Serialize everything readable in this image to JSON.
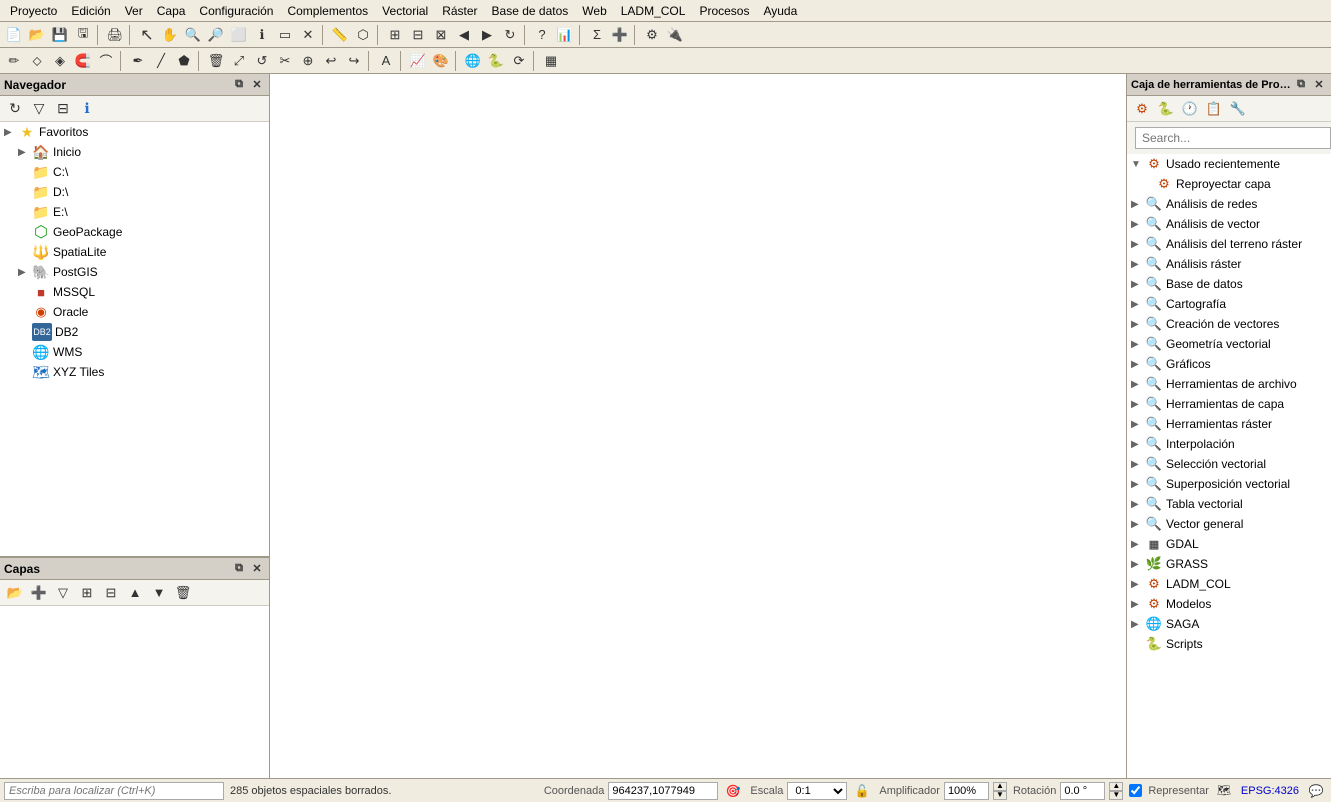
{
  "menu": {
    "items": [
      "Proyecto",
      "Edición",
      "Ver",
      "Capa",
      "Configuración",
      "Complementos",
      "Vectorial",
      "Ráster",
      "Base de datos",
      "Web",
      "LADM_COL",
      "Procesos",
      "Ayuda"
    ]
  },
  "navigator": {
    "title": "Navegador",
    "favorites_label": "Favoritos",
    "items": [
      {
        "label": "Inicio",
        "type": "folder",
        "hasArrow": true
      },
      {
        "label": "C:\\",
        "type": "folder",
        "hasArrow": false
      },
      {
        "label": "D:\\",
        "type": "folder",
        "hasArrow": false
      },
      {
        "label": "E:\\",
        "type": "folder",
        "hasArrow": false
      },
      {
        "label": "GeoPackage",
        "type": "geopkg",
        "hasArrow": false
      },
      {
        "label": "SpatiaLite",
        "type": "spatialite",
        "hasArrow": false
      },
      {
        "label": "PostGIS",
        "type": "postgis",
        "hasArrow": true
      },
      {
        "label": "MSSQL",
        "type": "mssql",
        "hasArrow": false
      },
      {
        "label": "Oracle",
        "type": "oracle",
        "hasArrow": false
      },
      {
        "label": "DB2",
        "type": "db2",
        "hasArrow": false
      },
      {
        "label": "WMS",
        "type": "wms",
        "hasArrow": false
      },
      {
        "label": "XYZ Tiles",
        "type": "xyz",
        "hasArrow": false
      }
    ]
  },
  "layers": {
    "title": "Capas"
  },
  "toolbox": {
    "title": "Caja de herramientas de Proc...",
    "search_placeholder": "Search...",
    "recently_used": "Usado recientemente",
    "recently_items": [
      "Reproyectar capa"
    ],
    "categories": [
      {
        "label": "Análisis de redes"
      },
      {
        "label": "Análisis de vector"
      },
      {
        "label": "Análisis del terreno ráster"
      },
      {
        "label": "Análisis ráster"
      },
      {
        "label": "Base de datos"
      },
      {
        "label": "Cartografía"
      },
      {
        "label": "Creación de vectores"
      },
      {
        "label": "Geometría vectorial"
      },
      {
        "label": "Gráficos"
      },
      {
        "label": "Herramientas de archivo"
      },
      {
        "label": "Herramientas de capa"
      },
      {
        "label": "Herramientas ráster"
      },
      {
        "label": "Interpolación"
      },
      {
        "label": "Selección vectorial"
      },
      {
        "label": "Superposición vectorial"
      },
      {
        "label": "Tabla vectorial"
      },
      {
        "label": "Vector general"
      },
      {
        "label": "GDAL"
      },
      {
        "label": "GRASS"
      },
      {
        "label": "LADM_COL"
      },
      {
        "label": "Modelos"
      },
      {
        "label": "SAGA"
      },
      {
        "label": "Scripts"
      }
    ]
  },
  "statusbar": {
    "search_placeholder": "Escriba para localizar (Ctrl+K)",
    "objects_deleted": "285 objetos espaciales borrados.",
    "coordenada_label": "Coordenada",
    "coordenada_value": "964237,1077949",
    "escala_label": "Escala",
    "escala_value": "0:1",
    "amplificador_label": "Amplificador",
    "amplificador_value": "100%",
    "rotacion_label": "Rotación",
    "rotacion_value": "0.0 °",
    "representar_label": "Representar",
    "epsg_value": "EPSG:4326"
  }
}
